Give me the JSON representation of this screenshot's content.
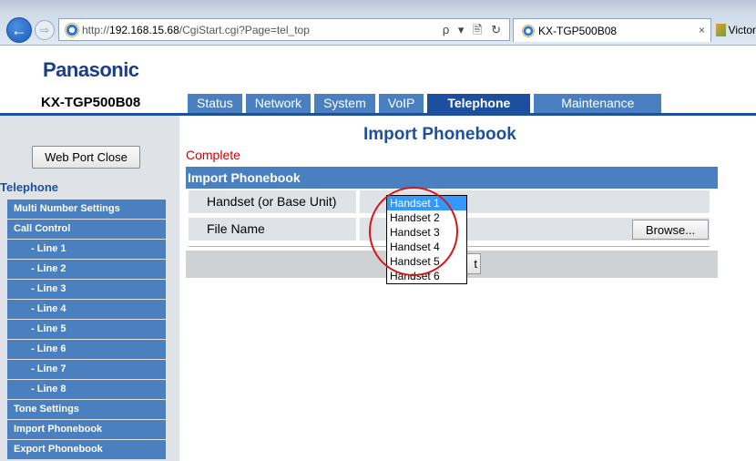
{
  "browser": {
    "url_prefix": "http://",
    "url_host": "192.168.15.68",
    "url_path": "/CgiStart.cgi?Page=tel_top",
    "address_tools": "ρ ▾ 🖹 ↻",
    "tab_title": "KX-TGP500B08",
    "tab_close": "×",
    "second_tab_title": "Victor"
  },
  "header": {
    "brand": "Panasonic",
    "model": "KX-TGP500B08",
    "tabs": [
      "Status",
      "Network",
      "System",
      "VoIP",
      "Telephone",
      "Maintenance"
    ],
    "active_tab": "Telephone"
  },
  "sidebar": {
    "close_button": "Web Port Close",
    "heading": "Telephone",
    "items": [
      {
        "label": "Multi Number Settings",
        "sub": false
      },
      {
        "label": "Call Control",
        "sub": false
      },
      {
        "label": "- Line 1",
        "sub": true
      },
      {
        "label": "- Line 2",
        "sub": true
      },
      {
        "label": "- Line 3",
        "sub": true
      },
      {
        "label": "- Line 4",
        "sub": true
      },
      {
        "label": "- Line 5",
        "sub": true
      },
      {
        "label": "- Line 6",
        "sub": true
      },
      {
        "label": "- Line 7",
        "sub": true
      },
      {
        "label": "- Line 8",
        "sub": true
      },
      {
        "label": "Tone Settings",
        "sub": false
      },
      {
        "label": "Import Phonebook",
        "sub": false
      },
      {
        "label": "Export Phonebook",
        "sub": false
      }
    ]
  },
  "main": {
    "title": "Import Phonebook",
    "status": "Complete",
    "section_title": "Import Phonebook",
    "handset_label": "Handset (or Base Unit)",
    "file_label": "File Name",
    "browse_button": "Browse...",
    "import_button_visible_text": "t"
  },
  "dropdown": {
    "options": [
      "Handset 1",
      "Handset 2",
      "Handset 3",
      "Handset 4",
      "Handset 5",
      "Handset 6"
    ],
    "selected": "Handset 1"
  },
  "colors": {
    "brand": "#1a3e8c",
    "tab": "#4a7fc0",
    "tab_active": "#1c4f9f",
    "status_text": "#d40000",
    "highlight": "#d81515",
    "selection": "#3399ff"
  }
}
